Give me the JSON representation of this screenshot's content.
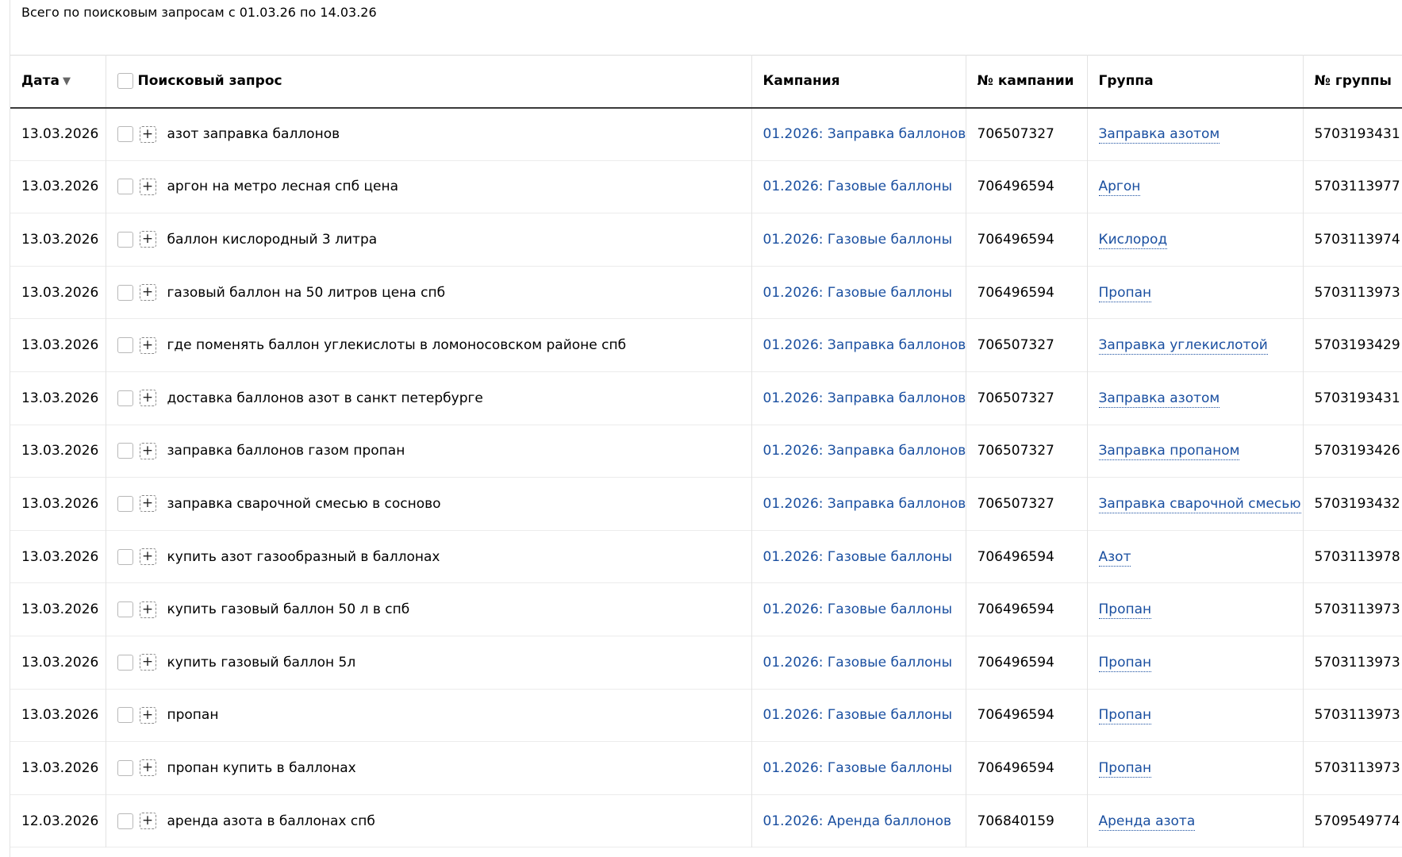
{
  "summary": "Всего по поисковым запросам с 01.03.26 по 14.03.26",
  "columns": {
    "date": "Дата",
    "query": "Поисковый запрос",
    "campaign": "Кампания",
    "campaign_no": "№ кампании",
    "group": "Группа",
    "group_no": "№ группы"
  },
  "icons": {
    "sort": "triangle-down-icon",
    "add": "plus-icon",
    "select": "checkbox-icon"
  },
  "colors": {
    "link": "#1a4fa0",
    "header_border": "#3a3a3a"
  },
  "rows": [
    {
      "date": "13.03.2026",
      "query": "азот заправка баллонов",
      "campaign": "01.2026: Заправка баллонов",
      "campaign_no": "706507327",
      "group": "Заправка азотом",
      "group_no": "5703193431"
    },
    {
      "date": "13.03.2026",
      "query": "аргон на метро лесная спб цена",
      "campaign": "01.2026: Газовые баллоны",
      "campaign_no": "706496594",
      "group": "Аргон",
      "group_no": "5703113977"
    },
    {
      "date": "13.03.2026",
      "query": "баллон кислородный 3 литра",
      "campaign": "01.2026: Газовые баллоны",
      "campaign_no": "706496594",
      "group": "Кислород",
      "group_no": "5703113974"
    },
    {
      "date": "13.03.2026",
      "query": "газовый баллон на 50 литров цена спб",
      "campaign": "01.2026: Газовые баллоны",
      "campaign_no": "706496594",
      "group": "Пропан",
      "group_no": "5703113973"
    },
    {
      "date": "13.03.2026",
      "query": "где поменять баллон углекислоты в ломоносовском районе спб",
      "campaign": "01.2026: Заправка баллонов",
      "campaign_no": "706507327",
      "group": "Заправка углекислотой",
      "group_no": "5703193429"
    },
    {
      "date": "13.03.2026",
      "query": "доставка баллонов азот в санкт петербурге",
      "campaign": "01.2026: Заправка баллонов",
      "campaign_no": "706507327",
      "group": "Заправка азотом",
      "group_no": "5703193431"
    },
    {
      "date": "13.03.2026",
      "query": "заправка баллонов газом пропан",
      "campaign": "01.2026: Заправка баллонов",
      "campaign_no": "706507327",
      "group": "Заправка пропаном",
      "group_no": "5703193426"
    },
    {
      "date": "13.03.2026",
      "query": "заправка сварочной смесью в сосново",
      "campaign": "01.2026: Заправка баллонов",
      "campaign_no": "706507327",
      "group": "Заправка сварочной смесью",
      "group_no": "5703193432"
    },
    {
      "date": "13.03.2026",
      "query": "купить азот газообразный в баллонах",
      "campaign": "01.2026: Газовые баллоны",
      "campaign_no": "706496594",
      "group": "Азот",
      "group_no": "5703113978"
    },
    {
      "date": "13.03.2026",
      "query": "купить газовый баллон 50 л в спб",
      "campaign": "01.2026: Газовые баллоны",
      "campaign_no": "706496594",
      "group": "Пропан",
      "group_no": "5703113973"
    },
    {
      "date": "13.03.2026",
      "query": "купить газовый баллон 5л",
      "campaign": "01.2026: Газовые баллоны",
      "campaign_no": "706496594",
      "group": "Пропан",
      "group_no": "5703113973"
    },
    {
      "date": "13.03.2026",
      "query": "пропан",
      "campaign": "01.2026: Газовые баллоны",
      "campaign_no": "706496594",
      "group": "Пропан",
      "group_no": "5703113973"
    },
    {
      "date": "13.03.2026",
      "query": "пропан купить в баллонах",
      "campaign": "01.2026: Газовые баллоны",
      "campaign_no": "706496594",
      "group": "Пропан",
      "group_no": "5703113973"
    },
    {
      "date": "12.03.2026",
      "query": "аренда азота в баллонах спб",
      "campaign": "01.2026: Аренда баллонов",
      "campaign_no": "706840159",
      "group": "Аренда азота",
      "group_no": "5709549774"
    }
  ]
}
